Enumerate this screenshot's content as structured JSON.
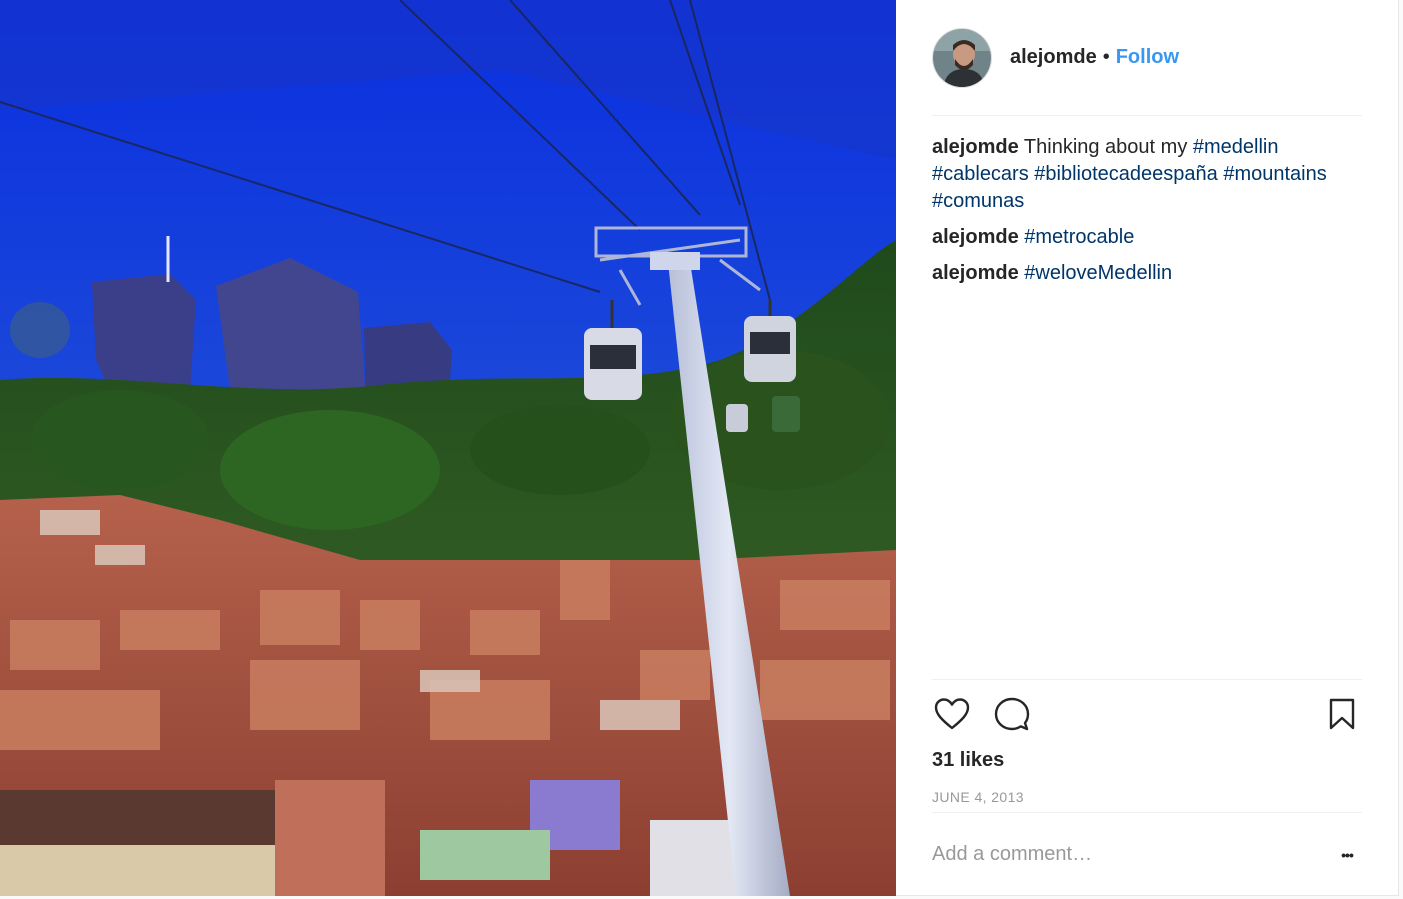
{
  "header": {
    "username": "alejomde",
    "separator": "•",
    "follow_label": "Follow"
  },
  "comments": [
    {
      "user": "alejomde",
      "text": "Thinking about my ",
      "tags": [
        "#medellin",
        "#cablecars",
        "#bibliotecadeespaña",
        "#mountains",
        "#comunas"
      ]
    },
    {
      "user": "alejomde",
      "text": "",
      "tags": [
        "#metrocable"
      ]
    },
    {
      "user": "alejomde",
      "text": "",
      "tags": [
        "#weloveMedellin"
      ]
    }
  ],
  "actions": {
    "like_icon": "heart-icon",
    "comment_icon": "comment-bubble-icon",
    "save_icon": "bookmark-icon"
  },
  "likes": "31 likes",
  "date": "JUNE 4, 2013",
  "comment_box": {
    "placeholder": "Add a comment…",
    "more_label": "•••"
  },
  "colors": {
    "link_blue": "#3897f0",
    "hashtag": "#003569",
    "muted": "#999999"
  }
}
